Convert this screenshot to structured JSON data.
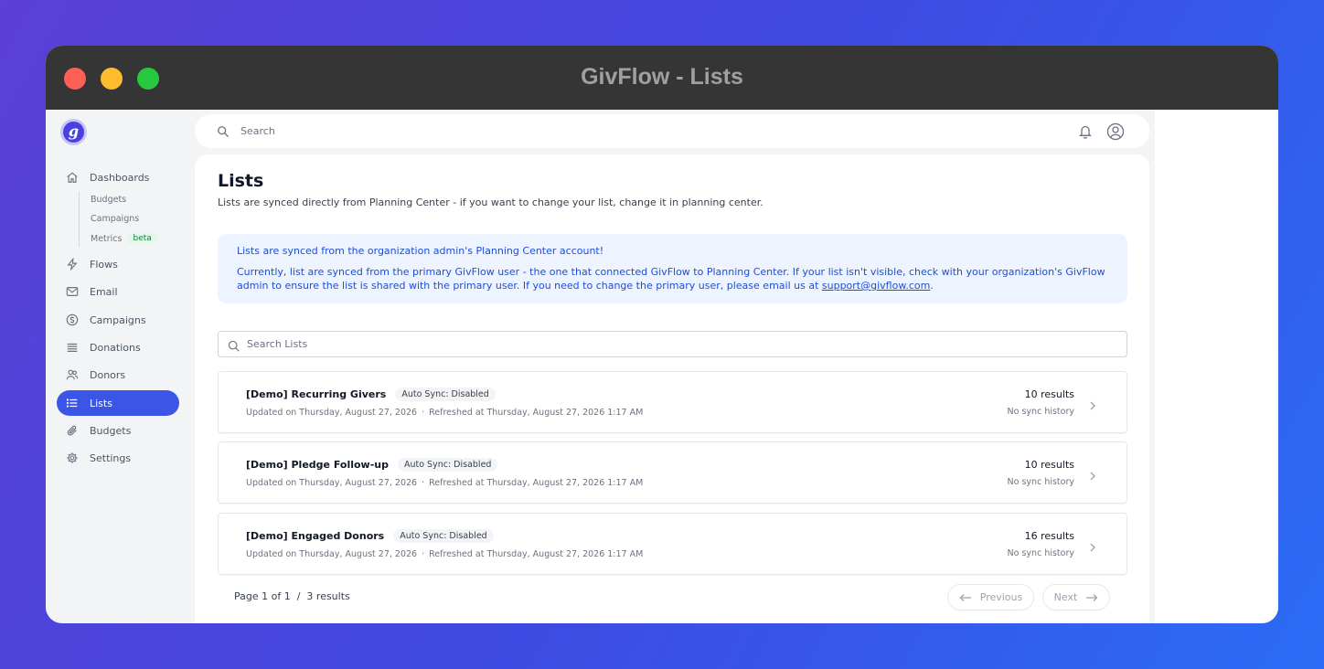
{
  "window": {
    "title": "GivFlow - Lists"
  },
  "sidebar": {
    "logo_letter": "g",
    "items": [
      {
        "label": "Dashboards",
        "icon": "home-icon"
      },
      {
        "label": "Flows",
        "icon": "lightning-icon"
      },
      {
        "label": "Email",
        "icon": "mail-icon"
      },
      {
        "label": "Campaigns",
        "icon": "dollar-circle-icon"
      },
      {
        "label": "Donations",
        "icon": "lines-icon"
      },
      {
        "label": "Donors",
        "icon": "users-icon"
      },
      {
        "label": "Lists",
        "icon": "list-icon",
        "active": true
      },
      {
        "label": "Budgets",
        "icon": "paperclip-icon"
      },
      {
        "label": "Settings",
        "icon": "gear-icon"
      }
    ],
    "dashboard_subitems": [
      {
        "label": "Budgets"
      },
      {
        "label": "Campaigns"
      },
      {
        "label": "Metrics",
        "badge": "beta"
      }
    ]
  },
  "topbar": {
    "search_placeholder": "Search"
  },
  "page": {
    "title": "Lists",
    "subtitle": "Lists are synced directly from Planning Center - if you want to change your list, change it in planning center."
  },
  "alert": {
    "title": "Lists are synced from the organization admin's Planning Center account!",
    "body": "Currently, list are synced from the primary GivFlow user - the one that connected GivFlow to Planning Center. If your list isn't visible, check with your organization's GivFlow admin to ensure the list is shared with the primary user. If you need to change the primary user, please email us at ",
    "email": "support@givflow.com",
    "body_end": "."
  },
  "list_search": {
    "placeholder": "Search Lists"
  },
  "lists": [
    {
      "name": "[Demo] Recurring Givers",
      "sync": "Auto Sync: Disabled",
      "updated": "Updated on Thursday, August 27, 2026",
      "refreshed": "Refreshed at Thursday, August 27, 2026 1:17 AM",
      "count": "10 results",
      "history": "No sync history"
    },
    {
      "name": "[Demo] Pledge Follow-up",
      "sync": "Auto Sync: Disabled",
      "updated": "Updated on Thursday, August 27, 2026",
      "refreshed": "Refreshed at Thursday, August 27, 2026 1:17 AM",
      "count": "10 results",
      "history": "No sync history"
    },
    {
      "name": "[Demo] Engaged Donors",
      "sync": "Auto Sync: Disabled",
      "updated": "Updated on Thursday, August 27, 2026",
      "refreshed": "Refreshed at Thursday, August 27, 2026 1:17 AM",
      "count": "16 results",
      "history": "No sync history"
    }
  ],
  "pagination": {
    "summary": "Page 1 of 1  /  3 results",
    "previous": "Previous",
    "next": "Next"
  },
  "colors": {
    "accent": "#3b55e6",
    "alert_bg": "#eef4ff",
    "alert_text": "#1d4ed8"
  }
}
